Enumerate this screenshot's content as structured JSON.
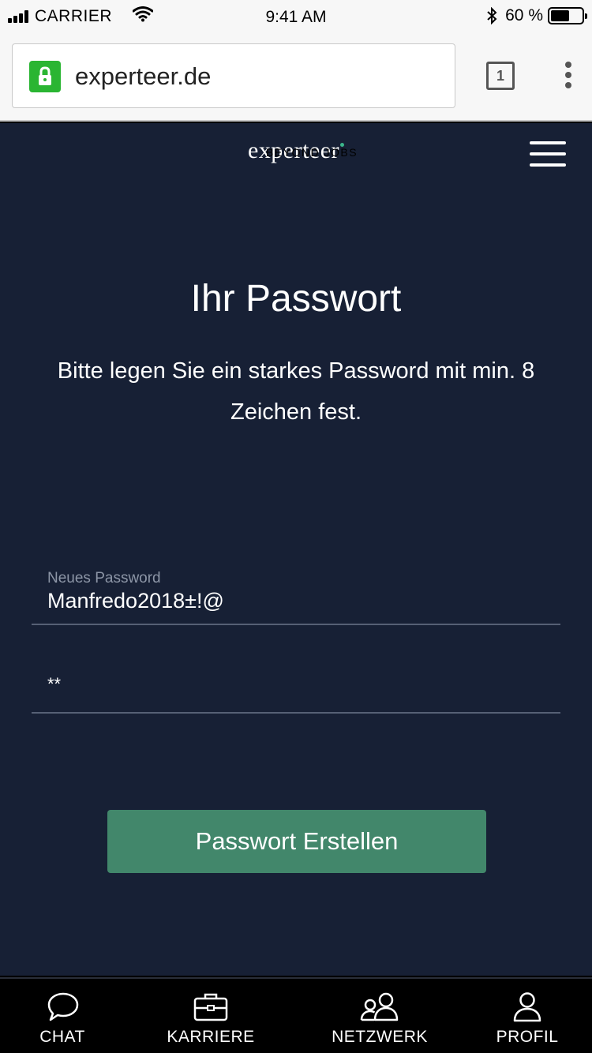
{
  "status_bar": {
    "carrier": "CARRIER",
    "time": "9:41 AM",
    "battery": "60 %",
    "battery_level": 0.6
  },
  "browser": {
    "url": "experteer.de",
    "tab_count": "1"
  },
  "header": {
    "logo_main": "experteer",
    "logo_sub": "BEYOND JOBS"
  },
  "main": {
    "title": "Ihr Passwort",
    "subtitle": "Bitte legen Sie ein starkes Password mit min. 8 Zeichen fest.",
    "password_label": "Neues Password",
    "password_value": "Manfredo2018±!@",
    "confirm_value": "**",
    "submit_label": "Passwort Erstellen"
  },
  "nav": {
    "items": [
      {
        "label": "CHAT",
        "icon": "chat-bubble-icon"
      },
      {
        "label": "KARRIERE",
        "icon": "briefcase-icon"
      },
      {
        "label": "NETZWERK",
        "icon": "people-icon"
      },
      {
        "label": "PROFIL",
        "icon": "user-icon"
      }
    ]
  },
  "colors": {
    "page_bg": "#172035",
    "button_bg": "#42876b",
    "lock_green": "#2ab532"
  }
}
